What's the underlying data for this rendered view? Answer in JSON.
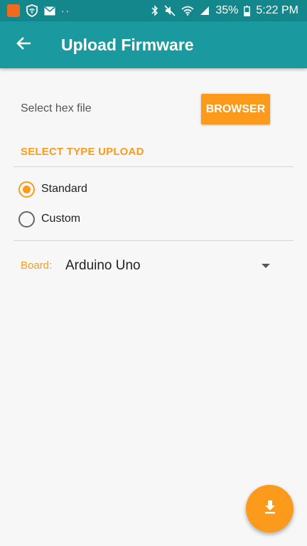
{
  "status_bar": {
    "battery_text": "35%",
    "time": "5:22 PM",
    "left_dots": "··",
    "icons": [
      "app-notification-icon",
      "shield-wifi-icon",
      "mail-icon",
      "bluetooth-icon",
      "mute-icon",
      "wifi-icon",
      "signal-icon",
      "battery-icon"
    ]
  },
  "app_bar": {
    "title": "Upload Firmware",
    "back_icon": "arrow-back-icon"
  },
  "file_select": {
    "label": "Select hex file",
    "button_label": "BROWSER"
  },
  "upload_type": {
    "section_title": "SELECT TYPE UPLOAD",
    "options": [
      {
        "label": "Standard",
        "selected": true
      },
      {
        "label": "Custom",
        "selected": false
      }
    ]
  },
  "board": {
    "label": "Board:",
    "value": "Arduino Uno"
  },
  "fab": {
    "icon": "download-icon"
  },
  "colors": {
    "status_bar": "#14878c",
    "app_bar": "#1a9a9f",
    "accent": "#fb9a1b",
    "background": "#f7f7f7"
  }
}
